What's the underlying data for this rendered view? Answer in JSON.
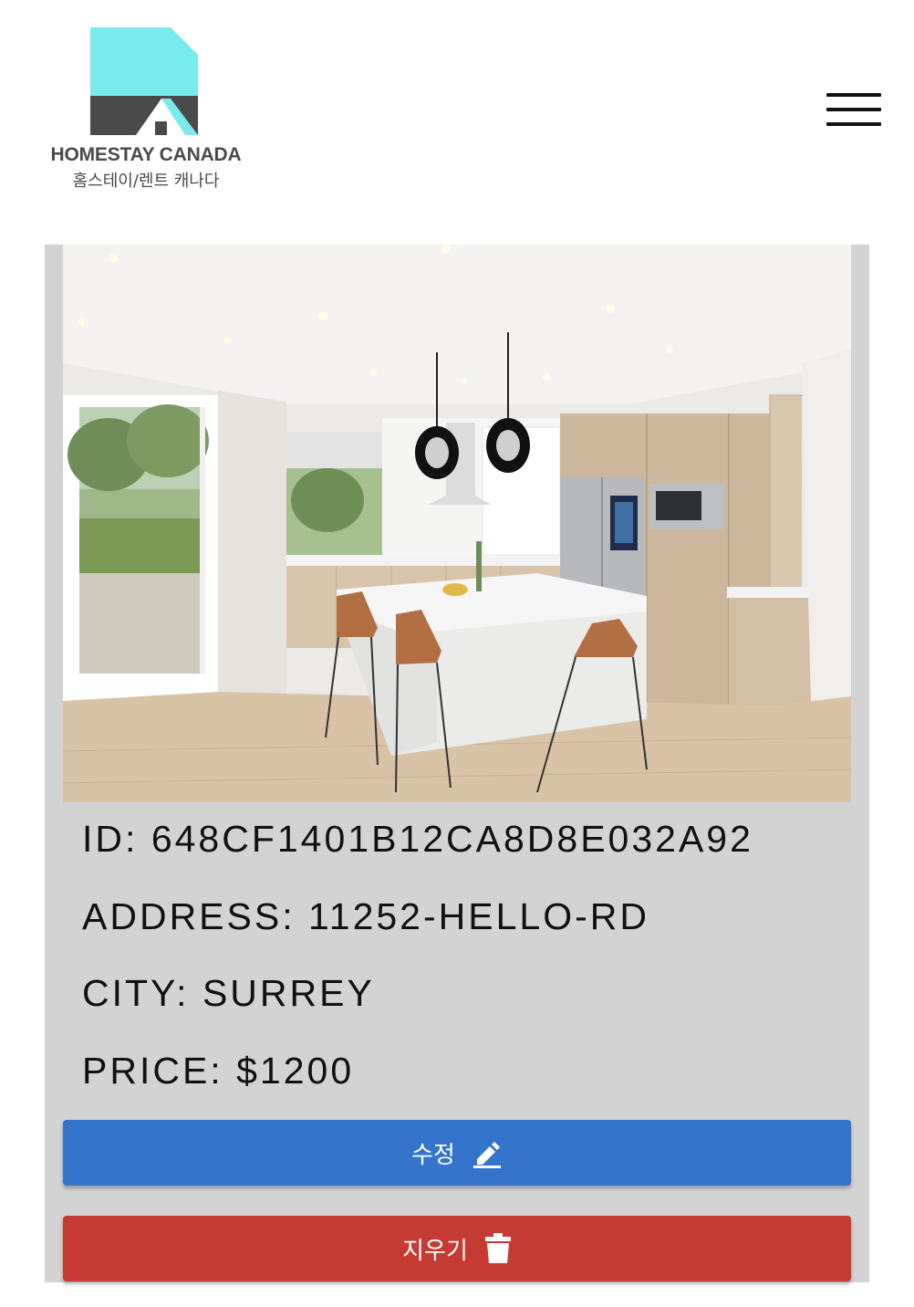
{
  "brand": {
    "name": "HOMESTAY CANADA",
    "subtitle": "홈스테이/렌트 캐나다",
    "colors": {
      "teal": "#7aebec",
      "dark": "#4a4a4a"
    }
  },
  "menu": {
    "icon": "hamburger-menu-icon"
  },
  "listing": {
    "image": {
      "description": "kitchen-photo"
    },
    "id_label": "ID:",
    "id_value": "648CF1401B12CA8D8E032A92",
    "address_label": "ADDRESS:",
    "address_value": "11252-HELLO-RD",
    "city_label": "CITY:",
    "city_value": "SURREY",
    "price_label": "PRICE:",
    "price_value": "$1200"
  },
  "actions": {
    "edit_label": "수정",
    "edit_icon": "pencil-icon",
    "edit_color": "#3474cb",
    "delete_label": "지우기",
    "delete_icon": "trash-icon",
    "delete_color": "#c53b34"
  }
}
